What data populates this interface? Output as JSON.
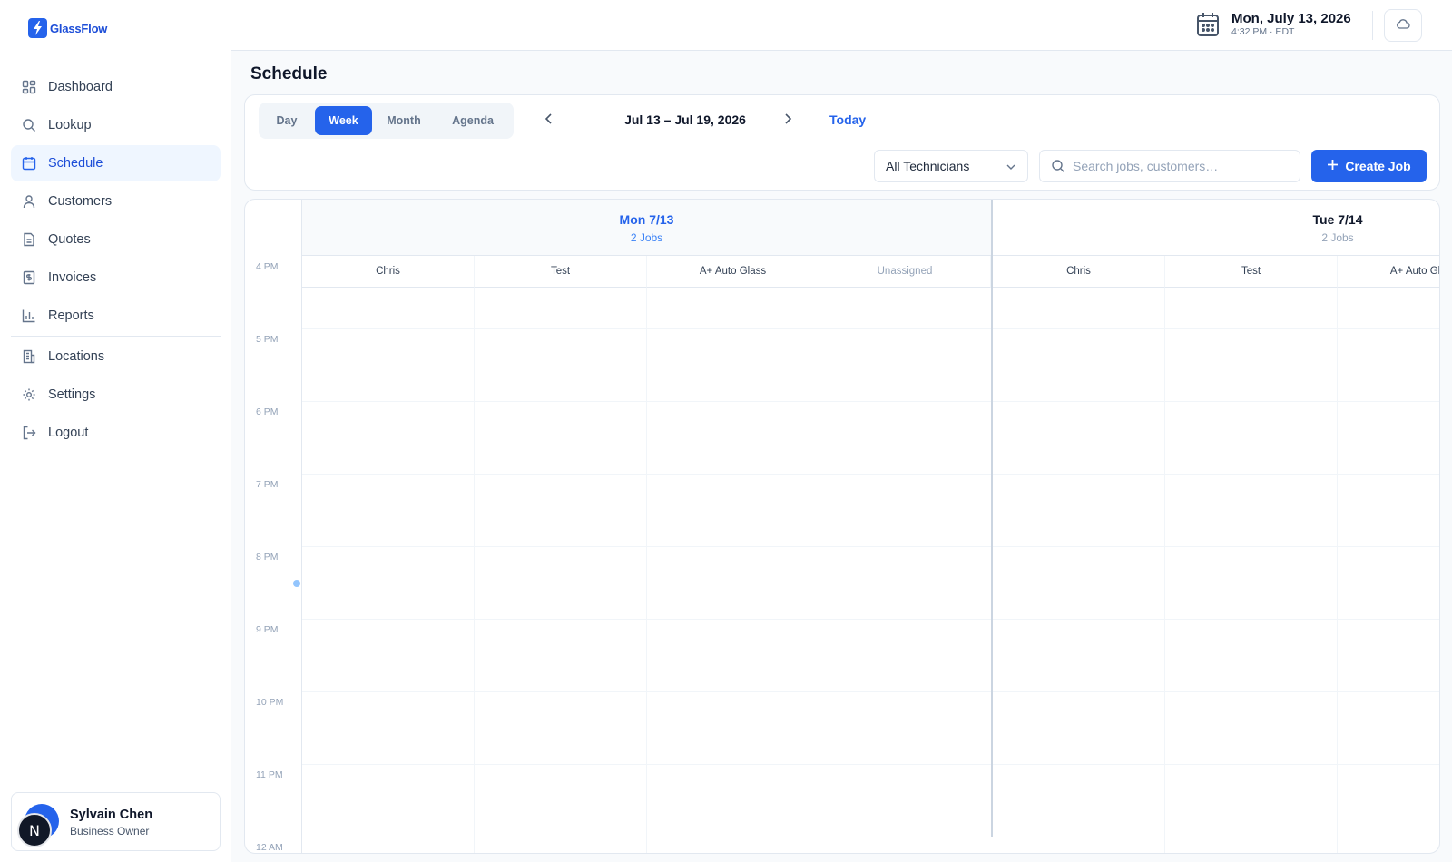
{
  "brand": {
    "name": "GlassFlow",
    "accent": "#2563eb"
  },
  "sidebar": {
    "items": [
      {
        "label": "Dashboard",
        "icon": "dashboard-icon"
      },
      {
        "label": "Lookup",
        "icon": "search-icon"
      },
      {
        "label": "Schedule",
        "icon": "calendar-icon",
        "active": true
      },
      {
        "label": "Customers",
        "icon": "user-icon"
      },
      {
        "label": "Quotes",
        "icon": "document-icon"
      },
      {
        "label": "Invoices",
        "icon": "invoice-icon"
      },
      {
        "label": "Reports",
        "icon": "bar-chart-icon"
      },
      {
        "label": "Locations",
        "icon": "building-icon"
      },
      {
        "label": "Settings",
        "icon": "gear-icon"
      },
      {
        "label": "Logout",
        "icon": "logout-icon"
      }
    ],
    "user": {
      "name": "Sylvain Chen",
      "role": "Business Owner",
      "avatar_letter": "N"
    }
  },
  "topbar": {
    "date": "Mon, July 13, 2026",
    "time": "4:32 PM · EDT"
  },
  "page": {
    "title": "Schedule"
  },
  "toolbar": {
    "views": [
      "Day",
      "Week",
      "Month",
      "Agenda"
    ],
    "active_view": "Week",
    "range": "Jul 13 – Jul 19, 2026",
    "today": "Today",
    "technician_filter": "All Technicians",
    "search_placeholder": "Search jobs, customers…",
    "create_label": "Create Job"
  },
  "calendar": {
    "hours": [
      "4 PM",
      "5 PM",
      "6 PM",
      "7 PM",
      "8 PM",
      "9 PM",
      "10 PM",
      "11 PM",
      "12 AM"
    ],
    "days": [
      {
        "title": "Mon 7/13",
        "count": "2 Jobs",
        "today": true,
        "columns": [
          "Chris",
          "Test",
          "A+ Auto Glass",
          "Unassigned"
        ]
      },
      {
        "title": "Tue 7/14",
        "count": "2 Jobs",
        "today": false,
        "columns": [
          "Chris",
          "Test",
          "A+ Auto Glass"
        ]
      }
    ]
  }
}
